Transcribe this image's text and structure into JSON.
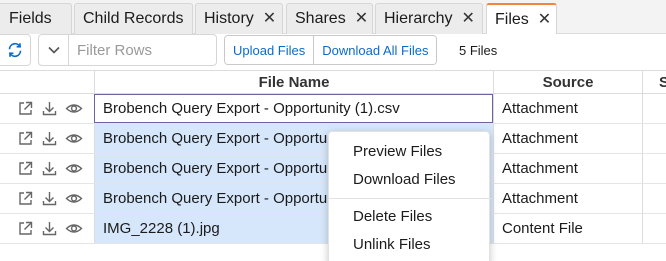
{
  "tabs": [
    {
      "label": "Fields",
      "closable": false,
      "active": false
    },
    {
      "label": "Child Records",
      "closable": false,
      "active": false
    },
    {
      "label": "History",
      "closable": true,
      "active": false
    },
    {
      "label": "Shares",
      "closable": true,
      "active": false
    },
    {
      "label": "Hierarchy",
      "closable": true,
      "active": false
    },
    {
      "label": "Files",
      "closable": true,
      "active": true
    }
  ],
  "tab_close_glyph": "✕",
  "toolbar": {
    "refresh_icon": "refresh-icon",
    "filter_placeholder": "Filter Rows",
    "upload_label": "Upload Files",
    "download_all_label": "Download All Files",
    "file_count": "5 Files"
  },
  "grid": {
    "columns": [
      "File Name",
      "Source",
      "S"
    ],
    "row_action_icons": [
      "open-external-icon",
      "download-icon",
      "preview-eye-icon"
    ],
    "rows": [
      {
        "file_name": "Brobench Query Export - Opportunity (1).csv",
        "source": "Attachment",
        "state": "focused"
      },
      {
        "file_name": "Brobench Query Export - Opportunity (1).csv",
        "source": "Attachment",
        "state": "selected"
      },
      {
        "file_name": "Brobench Query Export - Opportunity (1).csv",
        "source": "Attachment",
        "state": "selected"
      },
      {
        "file_name": "Brobench Query Export - Opportunity (1).csv",
        "source": "Attachment",
        "state": "selected"
      },
      {
        "file_name": "IMG_2228 (1).jpg",
        "source": "Content File",
        "state": "selected"
      }
    ]
  },
  "context_menu": {
    "items": [
      "Preview Files",
      "Download Files",
      "Delete Files",
      "Unlink Files"
    ]
  },
  "colors": {
    "accent": "#f2843f",
    "link": "#0b6bcb",
    "selection": "#d6e7fb",
    "focus_border": "#6f63a8"
  }
}
